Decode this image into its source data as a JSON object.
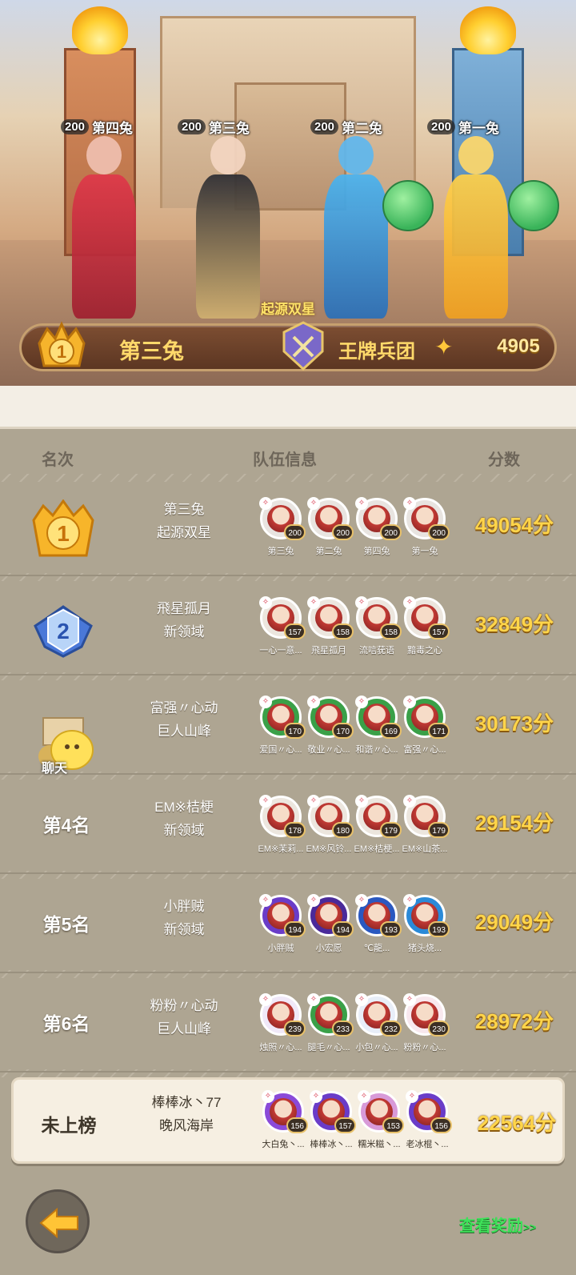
{
  "hero": {
    "players": [
      {
        "level": "200",
        "name": "第四兔"
      },
      {
        "level": "200",
        "name": "第三兔"
      },
      {
        "level": "200",
        "name": "第二兔"
      },
      {
        "level": "200",
        "name": "第一兔"
      }
    ],
    "title": "起源双星",
    "champion_name": "第三兔",
    "guild_name": "王牌兵团",
    "score": "4905"
  },
  "header": {
    "rank": "名次",
    "team": "队伍信息",
    "score": "分数"
  },
  "rows": [
    {
      "rank_label": "",
      "team": "第三兔",
      "server": "起源双星",
      "score": "49054分",
      "members": [
        {
          "level": "200",
          "name": "第三兔",
          "color": "#e8e4e0"
        },
        {
          "level": "200",
          "name": "第二兔",
          "color": "#e8e4e0"
        },
        {
          "level": "200",
          "name": "第四兔",
          "color": "#e8e4e0"
        },
        {
          "level": "200",
          "name": "第一兔",
          "color": "#e8e4e0"
        }
      ]
    },
    {
      "rank_label": "",
      "team": "飛星孤月",
      "server": "新领域",
      "score": "32849分",
      "members": [
        {
          "level": "157",
          "name": "一心一意...",
          "color": "#ece6de"
        },
        {
          "level": "158",
          "name": "飛星孤月",
          "color": "#ece6de"
        },
        {
          "level": "158",
          "name": "流唁莸语",
          "color": "#ece6de"
        },
        {
          "level": "157",
          "name": "黯毒之心",
          "color": "#ece6de"
        }
      ]
    },
    {
      "rank_label": "",
      "team": "富强〃心动",
      "server": "巨人山峰",
      "score": "30173分",
      "members": [
        {
          "level": "170",
          "name": "爱国〃心...",
          "color": "#3aa048"
        },
        {
          "level": "170",
          "name": "敬业〃心...",
          "color": "#3aa048"
        },
        {
          "level": "169",
          "name": "和谐〃心...",
          "color": "#3aa048"
        },
        {
          "level": "171",
          "name": "富强〃心...",
          "color": "#3aa048"
        }
      ]
    },
    {
      "rank_label": "第4名",
      "team": "EM※桔梗",
      "server": "新领域",
      "score": "29154分",
      "members": [
        {
          "level": "178",
          "name": "EM※茉莉...",
          "color": "#ece6de"
        },
        {
          "level": "180",
          "name": "EM※风铃...",
          "color": "#ece6de"
        },
        {
          "level": "179",
          "name": "EM※桔梗...",
          "color": "#ece6de"
        },
        {
          "level": "179",
          "name": "EM※山茶...",
          "color": "#ece6de"
        }
      ]
    },
    {
      "rank_label": "第5名",
      "team": "小胖贼",
      "server": "新领域",
      "score": "29049分",
      "members": [
        {
          "level": "194",
          "name": "小胖贼",
          "color": "#6a3cc8"
        },
        {
          "level": "194",
          "name": "小宏愿",
          "color": "#4a2a9a"
        },
        {
          "level": "193",
          "name": "℃龍...",
          "color": "#2a58c0"
        },
        {
          "level": "193",
          "name": "猪头烧...",
          "color": "#2a8ad8"
        }
      ]
    },
    {
      "rank_label": "第6名",
      "team": "粉粉〃心动",
      "server": "巨人山峰",
      "score": "28972分",
      "members": [
        {
          "level": "239",
          "name": "烛照〃心...",
          "color": "#f0e8f8"
        },
        {
          "level": "233",
          "name": "腿毛〃心...",
          "color": "#3aa048"
        },
        {
          "level": "232",
          "name": "小包〃心...",
          "color": "#e8eef8"
        },
        {
          "level": "230",
          "name": "粉粉〃心...",
          "color": "#f8e8ee"
        }
      ]
    },
    {
      "rank_label": "未上榜",
      "team": "棒棒冰丶77",
      "server": "晚风海岸",
      "score": "22564分",
      "members": [
        {
          "level": "156",
          "name": "大白兔丶...",
          "color": "#8a4ad8"
        },
        {
          "level": "157",
          "name": "棒棒冰丶...",
          "color": "#6a3cc8"
        },
        {
          "level": "153",
          "name": "糯米糍丶...",
          "color": "#d89ad8"
        },
        {
          "level": "156",
          "name": "老冰棍丶...",
          "color": "#6a3cc8"
        }
      ]
    }
  ],
  "chat_label": "聊天",
  "view_rewards": "查看奖励",
  "view_rewards_chevron": ">>",
  "colors": {
    "score_gold": "#ffd54a",
    "rewards_green": "#3ee25a",
    "panel_bg": "#aea592"
  }
}
